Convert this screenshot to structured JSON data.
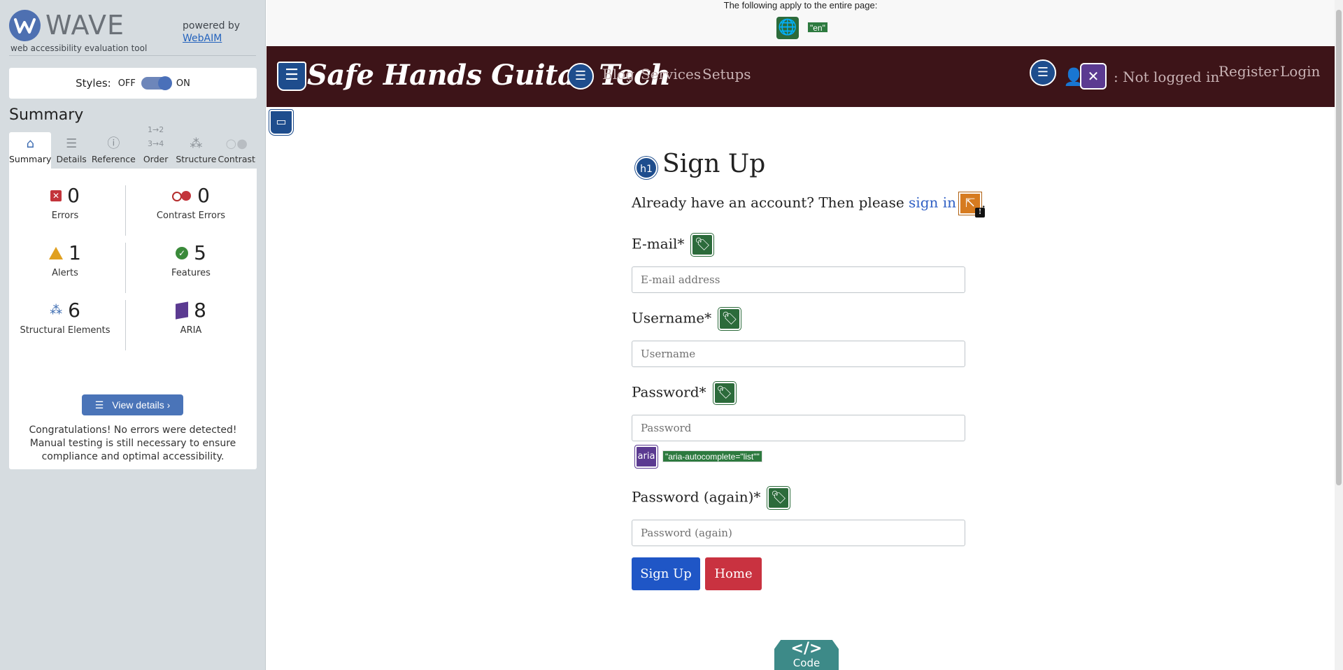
{
  "wave": {
    "logo": "WAVE",
    "tagline": "web accessibility evaluation tool",
    "powered_by": "powered by",
    "powered_link": "WebAIM",
    "styles_label": "Styles:",
    "styles_off": "OFF",
    "styles_on": "ON",
    "summary_title": "Summary",
    "tabs": [
      {
        "label": "Summary",
        "icon": "home-icon"
      },
      {
        "label": "Details",
        "icon": "list-icon"
      },
      {
        "label": "Reference",
        "icon": "info-icon"
      },
      {
        "label": "Order",
        "icon": "order-icon"
      },
      {
        "label": "Structure",
        "icon": "structure-icon"
      },
      {
        "label": "Contrast",
        "icon": "contrast-icon"
      }
    ],
    "stats": {
      "errors": {
        "value": "0",
        "label": "Errors"
      },
      "contrast_errors": {
        "value": "0",
        "label": "Contrast Errors"
      },
      "alerts": {
        "value": "1",
        "label": "Alerts"
      },
      "features": {
        "value": "5",
        "label": "Features"
      },
      "structural": {
        "value": "6",
        "label": "Structural Elements"
      },
      "aria": {
        "value": "8",
        "label": "ARIA"
      }
    },
    "view_details": "View details ›",
    "congrats": "Congratulations! No errors were detected! Manual testing is still necessary to ensure compliance and optimal accessibility."
  },
  "page": {
    "top_note": "The following apply to the entire page:",
    "lang_tag": "\"en\"",
    "brand": "Safe Hands Guitar Tech",
    "nav": {
      "blog": "Blog",
      "services": "Services",
      "setups": "Setups",
      "not_logged_in": ": Not logged in",
      "register": "Register",
      "login": "Login"
    },
    "heading_badge": "h1",
    "heading": "Sign Up",
    "signin_prefix": "Already have an account? Then please ",
    "signin_link": "sign in",
    "signin_suffix": ".",
    "fields": {
      "email_label": "E-mail*",
      "email_placeholder": "E-mail address",
      "username_label": "Username*",
      "username_placeholder": "Username",
      "password_label": "Password*",
      "password_placeholder": "Password",
      "password2_label": "Password (again)*",
      "password2_placeholder": "Password (again)"
    },
    "aria_badge": "aria",
    "aria_tag": "\"aria-autocomplete=\"list\"\"",
    "signup_button": "Sign Up",
    "home_button": "Home",
    "code_tab_icon": "</>",
    "code_tab": "Code"
  },
  "colors": {
    "nav_bg": "#3d1418",
    "wave_accent": "#4a74b8",
    "signup_btn": "#1f56c6",
    "home_btn": "#c93240",
    "feature_green": "#2c6b3b",
    "aria_purple": "#5b3a91"
  }
}
